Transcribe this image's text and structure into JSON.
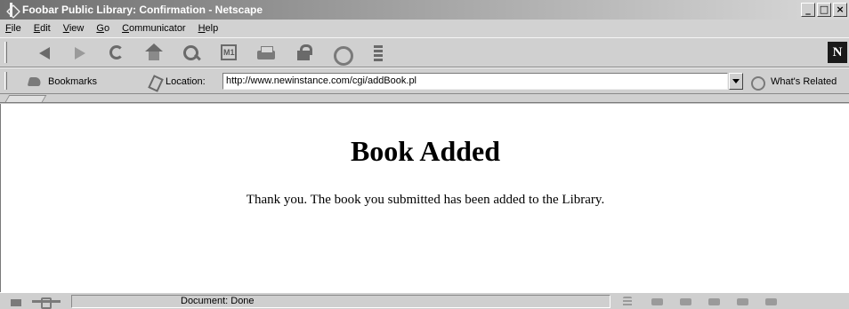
{
  "window": {
    "title": "Foobar Public Library: Confirmation - Netscape",
    "controls": {
      "minimize": "_",
      "maximize": "□",
      "close": "×"
    }
  },
  "menu": {
    "items": [
      {
        "label": "File",
        "underline": "F",
        "rest": "ile"
      },
      {
        "label": "Edit",
        "underline": "E",
        "rest": "dit"
      },
      {
        "label": "View",
        "underline": "V",
        "rest": "iew"
      },
      {
        "label": "Go",
        "underline": "G",
        "rest": "o"
      },
      {
        "label": "Communicator",
        "underline": "C",
        "rest": "ommunicator"
      },
      {
        "label": "Help",
        "underline": "H",
        "rest": "elp"
      }
    ]
  },
  "nav_toolbar": {
    "icons": [
      "back-icon",
      "forward-icon",
      "reload-icon",
      "home-icon",
      "search-icon",
      "netscape-guide-icon",
      "print-icon",
      "security-icon",
      "shop-icon",
      "stop-icon"
    ],
    "logo": "N"
  },
  "location_toolbar": {
    "bookmarks_label": "Bookmarks",
    "location_label": "Location:",
    "url": "http://www.newinstance.com/cgi/addBook.pl",
    "related_label": "What's Related"
  },
  "page": {
    "heading": "Book Added",
    "message": "Thank you. The book you submitted has been added to the Library."
  },
  "status_bar": {
    "status_text": "Document: Done"
  }
}
